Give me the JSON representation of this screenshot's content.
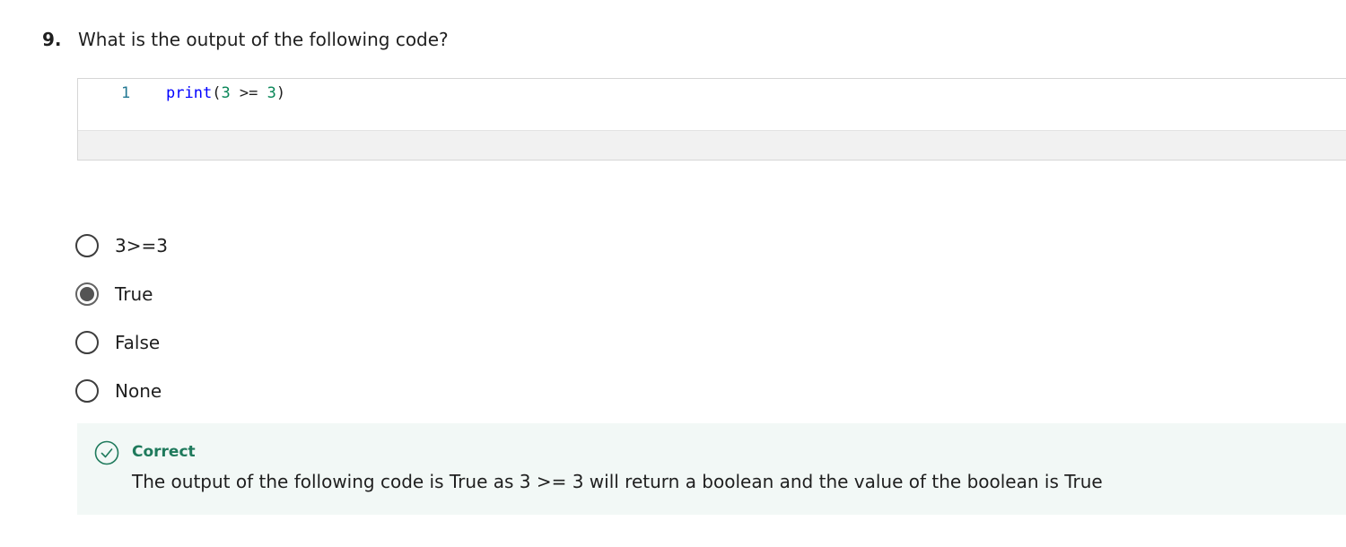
{
  "question": {
    "number": "9.",
    "prompt": "What is the output of the following code?"
  },
  "code": {
    "line_number": "1",
    "tokens": {
      "fn": "print",
      "open": "(",
      "num1": "3",
      "op": " >= ",
      "num2": "3",
      "close": ")"
    }
  },
  "options": [
    {
      "label": "3>=3",
      "selected": false
    },
    {
      "label": "True",
      "selected": true
    },
    {
      "label": "False",
      "selected": false
    },
    {
      "label": "None",
      "selected": false
    }
  ],
  "feedback": {
    "status": "Correct",
    "explanation": "The output of the following code is True as 3 >= 3 will return a boolean and the value of the boolean is True",
    "icon": "check-circle-icon",
    "accent_color": "#1f7a5c",
    "background_color": "#f2f8f6"
  }
}
